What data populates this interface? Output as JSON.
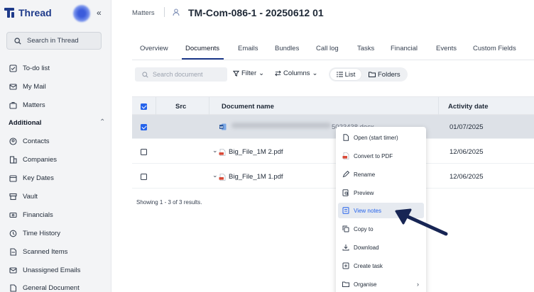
{
  "app": {
    "name": "Thread"
  },
  "sidebar": {
    "search_label": "Search in Thread",
    "items_top": [
      {
        "label": "To-do list",
        "icon": "todo-icon"
      },
      {
        "label": "My Mail",
        "icon": "mail-icon"
      },
      {
        "label": "Matters",
        "icon": "briefcase-icon"
      }
    ],
    "section_label": "Additional",
    "items_additional": [
      {
        "label": "Contacts",
        "icon": "contacts-icon"
      },
      {
        "label": "Companies",
        "icon": "companies-icon"
      },
      {
        "label": "Key Dates",
        "icon": "calendar-icon"
      },
      {
        "label": "Vault",
        "icon": "vault-icon"
      },
      {
        "label": "Financials",
        "icon": "financials-icon"
      },
      {
        "label": "Time History",
        "icon": "time-history-icon"
      },
      {
        "label": "Scanned Items",
        "icon": "scanned-icon"
      },
      {
        "label": "Unassigned Emails",
        "icon": "unassigned-mail-icon"
      },
      {
        "label": "General Document",
        "icon": "general-document-icon"
      }
    ]
  },
  "header": {
    "breadcrumb": "Matters",
    "matter_code": "TM-Com-086-1",
    "matter_ref": " - 20250612 01"
  },
  "tabs": [
    {
      "label": "Overview"
    },
    {
      "label": "Documents"
    },
    {
      "label": "Emails"
    },
    {
      "label": "Bundles"
    },
    {
      "label": "Call log"
    },
    {
      "label": "Tasks"
    },
    {
      "label": "Financial"
    },
    {
      "label": "Events"
    },
    {
      "label": "Custom Fields"
    }
  ],
  "toolbar": {
    "search_placeholder": "Search document",
    "filter_label": "Filter",
    "columns_label": "Columns",
    "list_label": "List",
    "folders_label": "Folders"
  },
  "table": {
    "columns": [
      "Src",
      "Document name",
      "Activity date"
    ],
    "rows": [
      {
        "name_suffix": "5023438.docx",
        "date": "01/07/2025",
        "checked": true
      },
      {
        "name": "Big_File_1M 2.pdf",
        "date": "12/06/2025",
        "checked": false
      },
      {
        "name": "Big_File_1M 1.pdf",
        "date": "12/06/2025",
        "checked": false
      }
    ],
    "summary": "Showing 1 - 3 of 3 results."
  },
  "context_menu": [
    {
      "label": "Open (start timer)",
      "icon": "open-file-icon"
    },
    {
      "label": "Convert to PDF",
      "icon": "pdf-icon"
    },
    {
      "label": "Rename",
      "icon": "pencil-icon"
    },
    {
      "label": "Preview",
      "icon": "preview-icon"
    },
    {
      "label": "View notes",
      "icon": "notes-icon"
    },
    {
      "label": "Copy to",
      "icon": "copy-icon"
    },
    {
      "label": "Download",
      "icon": "download-icon"
    },
    {
      "label": "Create task",
      "icon": "create-task-icon"
    },
    {
      "label": "Organise",
      "icon": "organise-icon"
    }
  ],
  "colors": {
    "brand": "#1e3a8a",
    "accent": "#2563eb",
    "pdf": "#d94a38",
    "word": "#2b579a"
  }
}
